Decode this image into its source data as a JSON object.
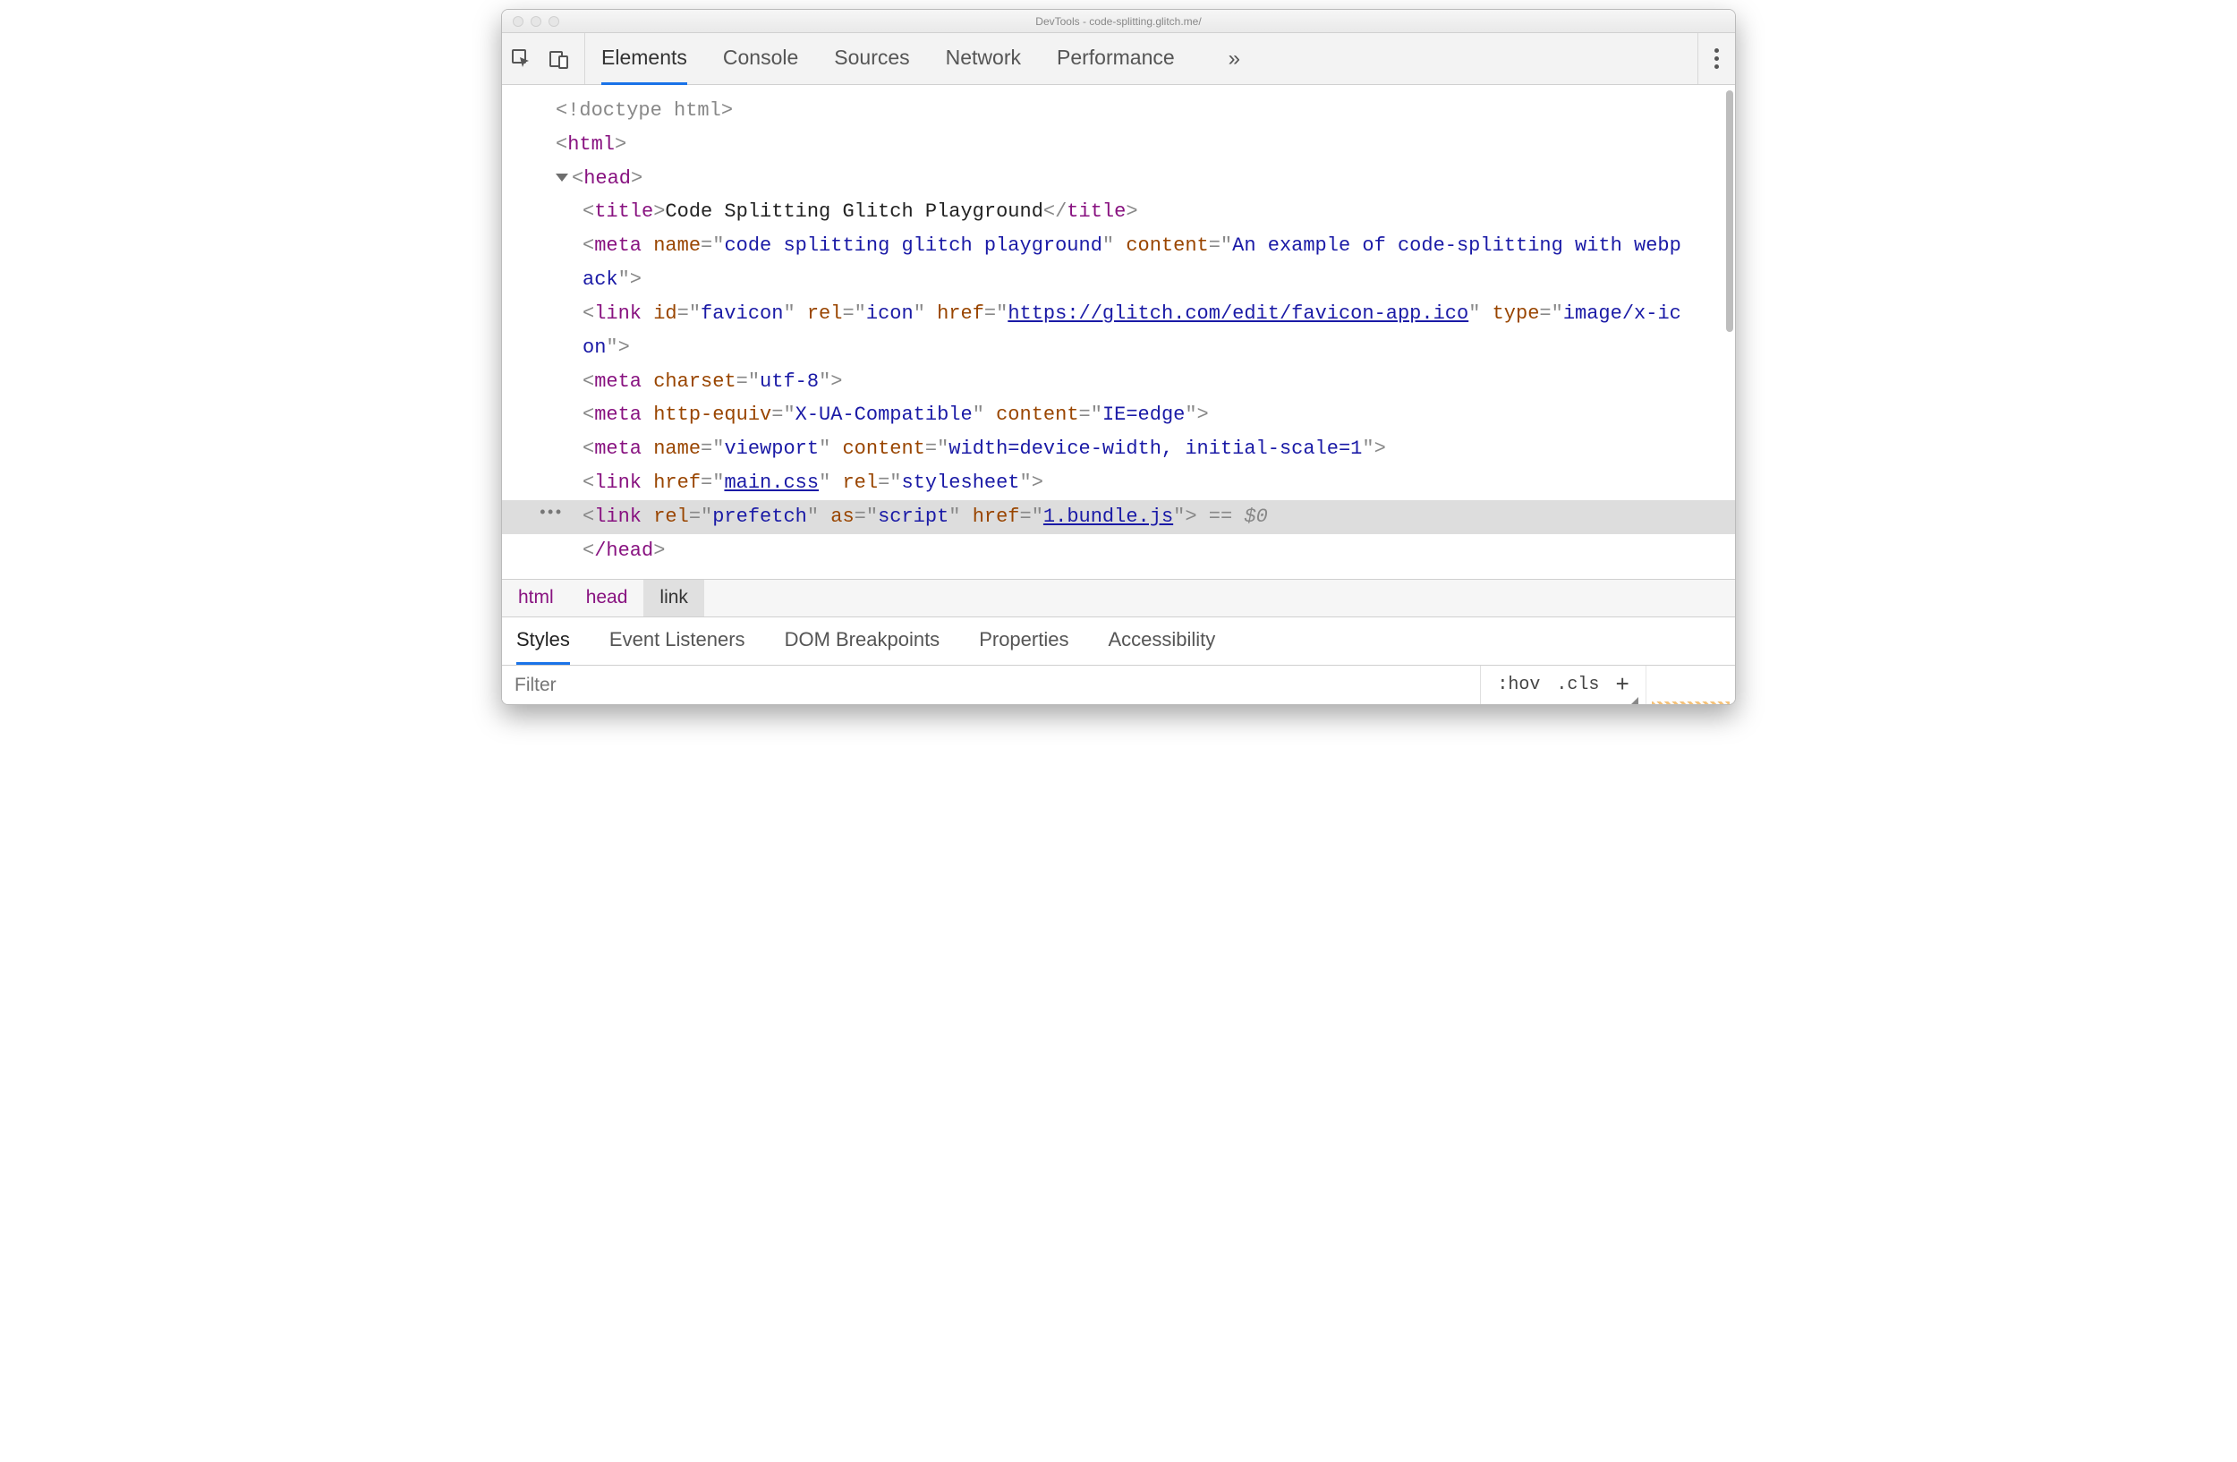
{
  "window_title": "DevTools - code-splitting.glitch.me/",
  "tabs": [
    "Elements",
    "Console",
    "Sources",
    "Network",
    "Performance"
  ],
  "active_tab": "Elements",
  "dom": {
    "doctype": "<!doctype html>",
    "html_open": "html",
    "head_open": "head",
    "head_close": "/head",
    "title_tag": "title",
    "title_text": "Code Splitting Glitch Playground",
    "meta1_attrs": {
      "name": "code splitting glitch playground",
      "content": "An example of code-splitting with webpack"
    },
    "link_favicon": {
      "id": "favicon",
      "rel": "icon",
      "href": "https://glitch.com/edit/favicon-app.ico",
      "type": "image/x-icon"
    },
    "meta_charset": "utf-8",
    "meta_httpequiv": {
      "http_equiv": "X-UA-Compatible",
      "content": "IE=edge"
    },
    "meta_viewport": {
      "name": "viewport",
      "content": "width=device-width, initial-scale=1"
    },
    "link_css": {
      "href": "main.css",
      "rel": "stylesheet"
    },
    "link_prefetch": {
      "rel": "prefetch",
      "as": "script",
      "href": "1.bundle.js"
    },
    "selected_suffix": " == $0"
  },
  "breadcrumbs": [
    "html",
    "head",
    "link"
  ],
  "active_crumb": "link",
  "subtabs": [
    "Styles",
    "Event Listeners",
    "DOM Breakpoints",
    "Properties",
    "Accessibility"
  ],
  "active_subtab": "Styles",
  "filter_placeholder": "Filter",
  "hov_label": ":hov",
  "cls_label": ".cls"
}
